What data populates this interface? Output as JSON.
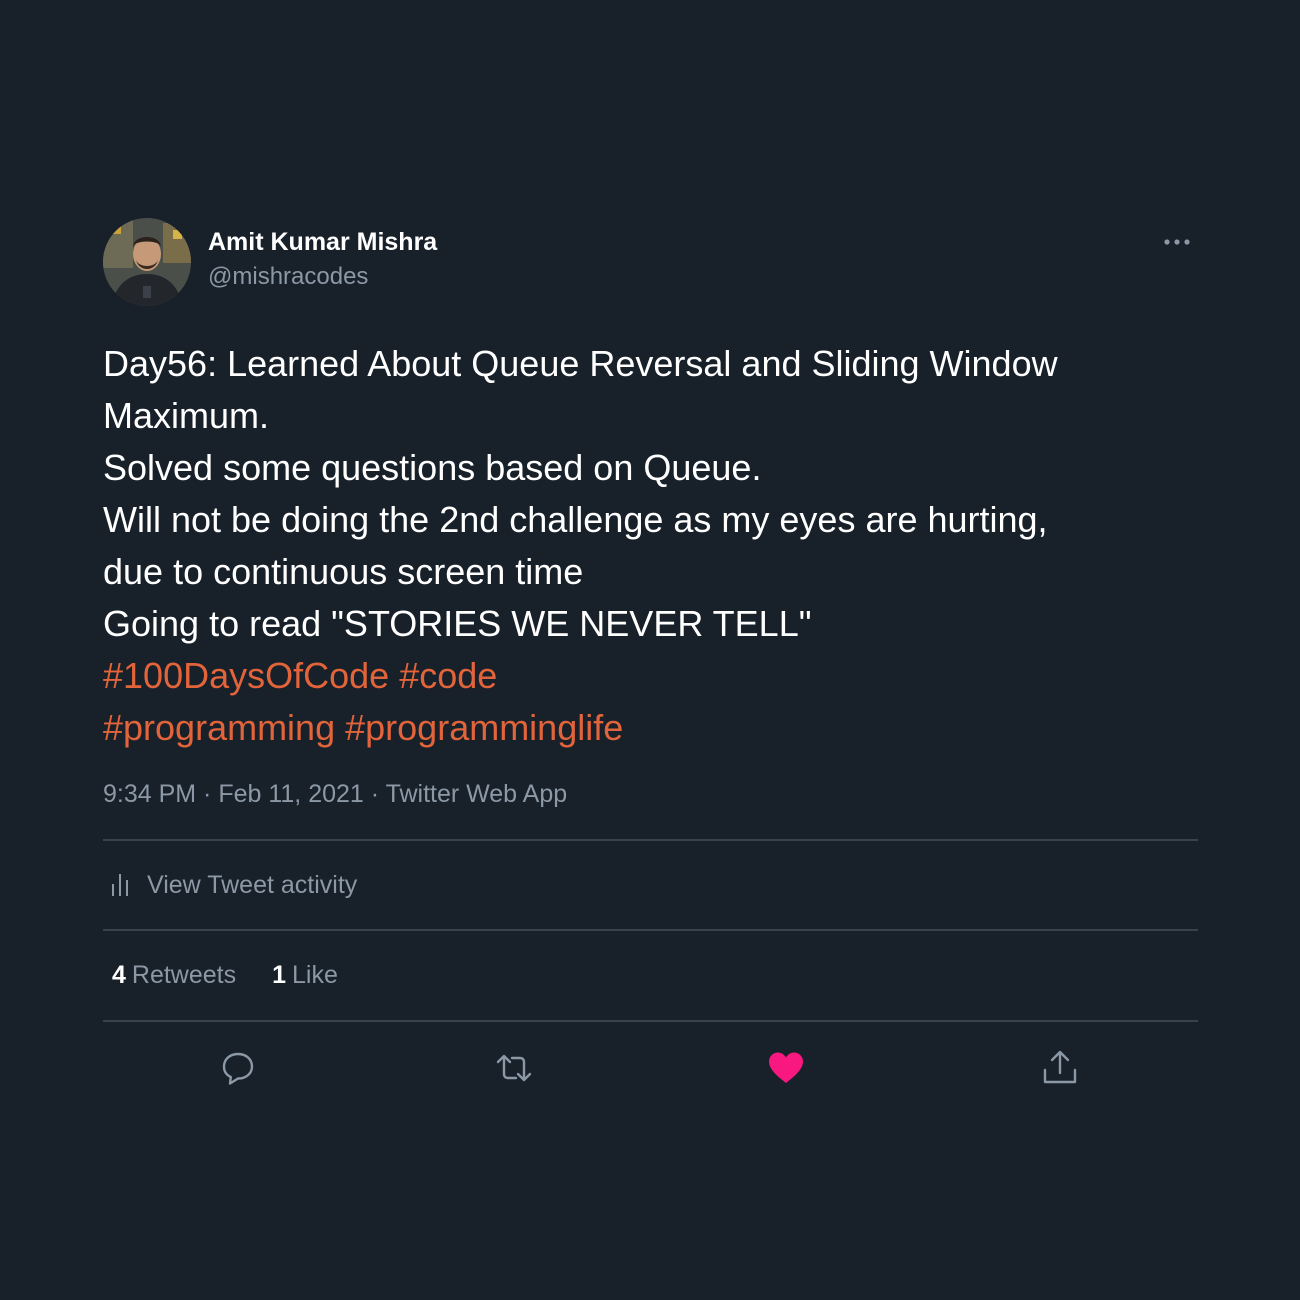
{
  "author": {
    "name": "Amit Kumar Mishra",
    "handle": "@mishracodes"
  },
  "tweet": {
    "lines": [
      "Day56: Learned About Queue Reversal and Sliding Window",
      "Maximum.",
      "Solved some questions based on Queue.",
      "Will not be doing the 2nd challenge as my eyes are hurting,",
      "due to continuous screen time",
      "Going to read \"STORIES WE NEVER TELL\""
    ],
    "hashtags": [
      "#100DaysOfCode",
      "#code",
      "#programming",
      "#programminglife"
    ],
    "timestamp": "9:34 PM · Feb 11, 2021 · Twitter Web App"
  },
  "activity": {
    "label": "View Tweet activity"
  },
  "stats": {
    "retweets_count": "4",
    "retweets_label": "Retweets",
    "likes_count": "1",
    "likes_label": "Like"
  },
  "colors": {
    "background": "#18202a",
    "hashtag": "#e2643a",
    "like_active": "#f91880",
    "muted_text": "#8b98a5"
  },
  "icons": {
    "more": "more-horizontal-icon",
    "activity": "bar-chart-icon",
    "reply": "reply-bubble-icon",
    "retweet": "retweet-arrows-icon",
    "like": "heart-filled-icon",
    "share": "share-upload-icon"
  }
}
